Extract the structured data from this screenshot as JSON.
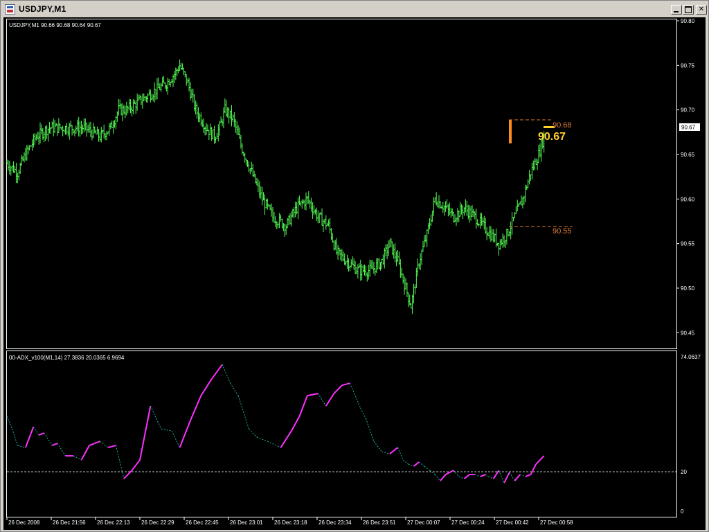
{
  "window": {
    "title": "USDJPY,M1",
    "buttons": {
      "minimize": "",
      "maximize": "",
      "close": "✕"
    }
  },
  "main_chart": {
    "info": "USDJPY,M1  90.66 90.68 90.64 90.67",
    "last_price_tag": "90.67",
    "annotations": {
      "high_label": "90.68",
      "current_label": "90.67",
      "low_label": "90.55"
    }
  },
  "indicator": {
    "info": "00-ADX_v100(M1,14) 27.3836 20.0365 6.9694",
    "axis_ticks": [
      "74.0637",
      "20",
      "0"
    ],
    "level_line": 20
  },
  "time_axis": [
    "26 Dec 2008",
    "26 Dec 21:56",
    "26 Dec 22:13",
    "26 Dec 22:29",
    "26 Dec 22:45",
    "26 Dec 23:01",
    "26 Dec 23:18",
    "26 Dec 23:34",
    "26 Dec 23:51",
    "27 Dec 00:07",
    "27 Dec 00:24",
    "27 Dec 00:42",
    "27 Dec 00:58"
  ],
  "chart_data": [
    {
      "type": "ohlc-bars",
      "symbol": "USDJPY",
      "timeframe": "M1",
      "ylim": [
        90.43,
        90.8
      ],
      "yticks": [
        "90.80",
        "90.75",
        "90.70",
        "90.65",
        "90.60",
        "90.55",
        "90.50",
        "90.45"
      ],
      "close_path": [
        [
          0,
          90.64
        ],
        [
          8,
          90.63
        ],
        [
          14,
          90.65
        ],
        [
          22,
          90.67
        ],
        [
          32,
          90.68
        ],
        [
          46,
          90.68
        ],
        [
          58,
          90.68
        ],
        [
          70,
          90.67
        ],
        [
          78,
          90.68
        ],
        [
          84,
          90.7
        ],
        [
          90,
          90.7
        ],
        [
          100,
          90.71
        ],
        [
          110,
          90.72
        ],
        [
          120,
          90.73
        ],
        [
          126,
          90.74
        ],
        [
          130,
          90.75
        ],
        [
          136,
          90.73
        ],
        [
          142,
          90.7
        ],
        [
          150,
          90.68
        ],
        [
          156,
          90.67
        ],
        [
          160,
          90.68
        ],
        [
          164,
          90.7
        ],
        [
          170,
          90.69
        ],
        [
          176,
          90.66
        ],
        [
          184,
          90.63
        ],
        [
          192,
          90.6
        ],
        [
          200,
          90.58
        ],
        [
          210,
          90.57
        ],
        [
          218,
          90.59
        ],
        [
          226,
          90.6
        ],
        [
          234,
          90.58
        ],
        [
          242,
          90.57
        ],
        [
          248,
          90.54
        ],
        [
          256,
          90.53
        ],
        [
          264,
          90.52
        ],
        [
          274,
          90.52
        ],
        [
          282,
          90.53
        ],
        [
          288,
          90.55
        ],
        [
          294,
          90.53
        ],
        [
          300,
          90.5
        ],
        [
          304,
          90.48
        ],
        [
          310,
          90.53
        ],
        [
          316,
          90.56
        ],
        [
          322,
          90.6
        ],
        [
          330,
          90.59
        ],
        [
          336,
          90.58
        ],
        [
          344,
          90.59
        ],
        [
          352,
          90.58
        ],
        [
          358,
          90.57
        ],
        [
          364,
          90.56
        ],
        [
          370,
          90.55
        ],
        [
          376,
          90.56
        ],
        [
          382,
          90.58
        ],
        [
          388,
          90.6
        ],
        [
          394,
          90.63
        ],
        [
          400,
          90.65
        ],
        [
          404,
          90.67
        ]
      ]
    },
    {
      "type": "line",
      "name": "00-ADX_v100(M1,14)",
      "ylim": [
        0,
        74.0637
      ],
      "level": 20,
      "x": [
        0,
        4,
        8,
        14,
        20,
        24,
        28,
        34,
        38,
        44,
        50,
        56,
        62,
        66,
        70,
        76,
        82,
        88,
        94,
        100,
        108,
        116,
        124,
        130,
        138,
        146,
        154,
        162,
        168,
        174,
        182,
        188,
        196,
        206,
        214,
        220,
        226,
        234,
        240,
        246,
        252,
        258,
        266,
        270,
        276,
        282,
        288,
        294,
        298,
        302,
        306,
        310,
        314,
        318,
        322,
        326,
        330,
        336,
        340,
        344,
        348,
        352,
        356,
        360,
        362,
        366,
        370,
        374,
        378,
        382,
        386,
        390,
        394,
        398,
        404
      ],
      "y": [
        46,
        40,
        32,
        31,
        41,
        37,
        38,
        32,
        33,
        27,
        27,
        25,
        32,
        33,
        34,
        31,
        32,
        16,
        20,
        25,
        51,
        40,
        39,
        31,
        44,
        56,
        64,
        71,
        62,
        56,
        40,
        36,
        34,
        31,
        39,
        46,
        56,
        57,
        51,
        57,
        61,
        62,
        50,
        45,
        34,
        29,
        28,
        31,
        25,
        23,
        22,
        24,
        22,
        20,
        18,
        15,
        18,
        20,
        17,
        16,
        18,
        18,
        17,
        18,
        17,
        16,
        20,
        14,
        19,
        15,
        18,
        17,
        18,
        23,
        27
      ]
    }
  ]
}
